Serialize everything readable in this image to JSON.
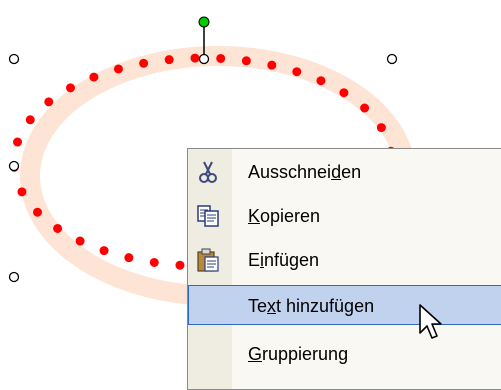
{
  "context_menu": {
    "items": [
      {
        "label_pre": "Ausschnei",
        "label_key": "d",
        "label_post": "en",
        "icon": "scissors-icon",
        "highlighted": false
      },
      {
        "label_pre": "",
        "label_key": "K",
        "label_post": "opieren",
        "icon": "copy-icon",
        "highlighted": false
      },
      {
        "label_pre": "E",
        "label_key": "i",
        "label_post": "nfügen",
        "icon": "paste-icon",
        "highlighted": false
      },
      {
        "label_pre": "Te",
        "label_key": "x",
        "label_post": "t hinzufügen",
        "icon": "",
        "highlighted": true
      },
      {
        "label_pre": "",
        "label_key": "G",
        "label_post": "ruppierung",
        "icon": "",
        "highlighted": false
      }
    ]
  },
  "shape": {
    "type": "ellipse",
    "outline_style": "dotted",
    "outline_color": "#ff0000",
    "shadow_color": "#fde4d4",
    "rotation_handle_color": "#00cc00"
  },
  "colors": {
    "menu_background": "#f9f8f3",
    "menu_gutter": "#efede2",
    "highlight_background": "#c1d2ee",
    "highlight_border": "#316ac5"
  }
}
